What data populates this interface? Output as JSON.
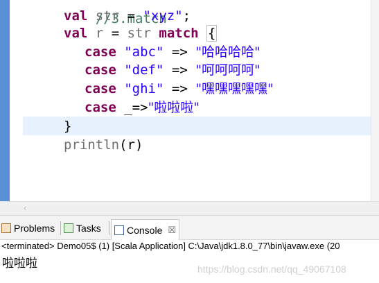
{
  "editor": {
    "line0": {
      "comment": "//3.match"
    },
    "line1": {
      "kw": "val",
      "name": "str",
      "eq": "=",
      "value": "\"xyz\"",
      "semi": ";"
    },
    "line2": {
      "kw": "val",
      "name": "r",
      "eq": "=",
      "subject": "str",
      "kw2": "match",
      "brace": "{"
    },
    "cases": [
      {
        "kw": "case",
        "pattern": "\"abc\"",
        "arrow": "=>",
        "result": "\"哈哈哈哈\""
      },
      {
        "kw": "case",
        "pattern": "\"def\"",
        "arrow": "=>",
        "result": "\"呵呵呵呵\""
      },
      {
        "kw": "case",
        "pattern": "\"ghi\"",
        "arrow": "=>",
        "result": "\"嘿嘿嘿嘿嘿\""
      },
      {
        "kw": "case",
        "pattern": "_",
        "arrow": "=>",
        "result": "\"啦啦啦\""
      }
    ],
    "close_brace": "}",
    "println": {
      "fn": "println",
      "arg": "(r)"
    }
  },
  "tabs": [
    {
      "label": "Problems",
      "icon": "problems-icon"
    },
    {
      "label": "Tasks",
      "icon": "tasks-icon"
    },
    {
      "label": "Console",
      "icon": "console-icon",
      "close": "☒"
    }
  ],
  "console": {
    "terminated_line": "<terminated> Demo05$ (1) [Scala Application] C:\\Java\\jdk1.8.0_77\\bin\\javaw.exe (20",
    "output": "啦啦啦",
    "watermark": "https://blog.csdn.net/qq_49067108"
  },
  "colors": {
    "keyword": "#7f0055",
    "string": "#2a00ff",
    "identifier": "#6f6f6f",
    "current_line": "#e8f2fe",
    "ruler": "#5b8fd6"
  }
}
